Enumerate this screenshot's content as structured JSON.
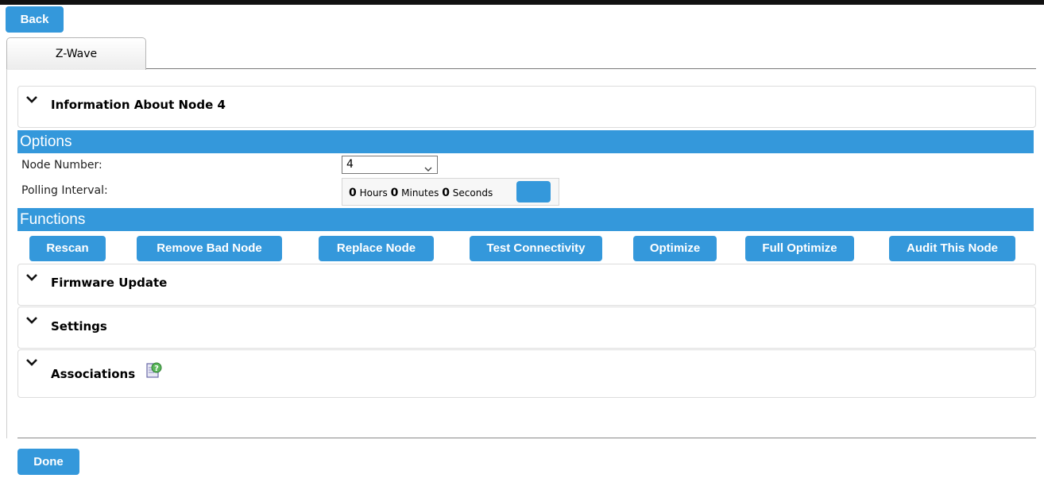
{
  "header": {
    "back_label": "Back"
  },
  "tabs": [
    {
      "label": "Z-Wave"
    }
  ],
  "panels": {
    "info": "Information About Node 4",
    "firmware": "Firmware Update",
    "settings": "Settings",
    "associations": "Associations"
  },
  "options": {
    "title": "Options",
    "node_number_label": "Node Number:",
    "node_number_value": "4",
    "polling_label": "Polling Interval:",
    "polling": {
      "hours": "0",
      "hours_label": "Hours",
      "minutes": "0",
      "minutes_label": "Minutes",
      "seconds": "0",
      "seconds_label": "Seconds"
    }
  },
  "functions": {
    "title": "Functions",
    "buttons": [
      "Rescan",
      "Remove Bad Node",
      "Replace Node",
      "Test Connectivity",
      "Optimize",
      "Full Optimize",
      "Audit This Node"
    ]
  },
  "footer": {
    "done_label": "Done"
  },
  "colors": {
    "accent": "#3498db",
    "topbar": "#111111"
  },
  "icons": {
    "panel_toggle": "chevron-down-icon",
    "associations": "help-document-icon"
  }
}
